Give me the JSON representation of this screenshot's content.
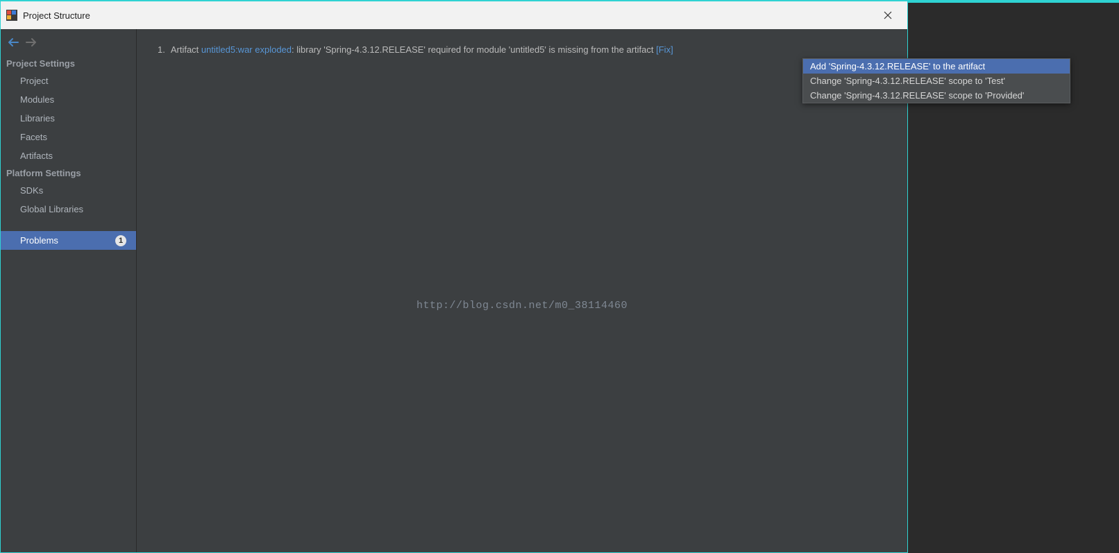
{
  "titlebar": {
    "title": "Project Structure"
  },
  "sidebar": {
    "section_project": "Project Settings",
    "items_project": [
      {
        "label": "Project"
      },
      {
        "label": "Modules"
      },
      {
        "label": "Libraries"
      },
      {
        "label": "Facets"
      },
      {
        "label": "Artifacts"
      }
    ],
    "section_platform": "Platform Settings",
    "items_platform": [
      {
        "label": "SDKs"
      },
      {
        "label": "Global Libraries"
      }
    ],
    "problems": {
      "label": "Problems",
      "count": "1"
    }
  },
  "content": {
    "problem": {
      "index": "1.",
      "prefix": "Artifact ",
      "artifact_link": "untitled5:war exploded",
      "message": ": library 'Spring-4.3.12.RELEASE' required for module 'untitled5' is missing from the artifact ",
      "fix_label": "[Fix]"
    }
  },
  "popup": {
    "items": [
      "Add 'Spring-4.3.12.RELEASE' to the artifact",
      "Change 'Spring-4.3.12.RELEASE' scope to 'Test'",
      "Change 'Spring-4.3.12.RELEASE' scope to 'Provided'"
    ]
  },
  "watermark": "http://blog.csdn.net/m0_38114460"
}
